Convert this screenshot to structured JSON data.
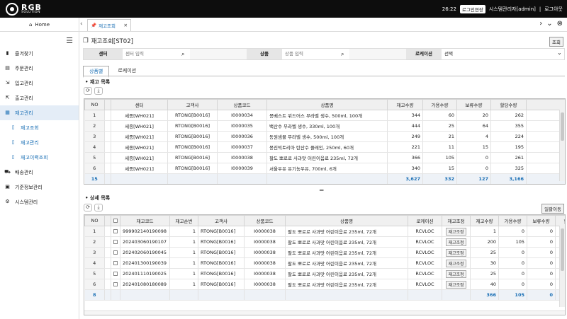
{
  "topbar": {
    "logo_main": "RGB",
    "logo_sub": "SOLUTION",
    "time": "26:22",
    "extend_label": "로그인연장",
    "user": "시스템관리자[admin]",
    "separator": "|",
    "logout": "로그아웃"
  },
  "nav": {
    "home": "Home",
    "tab_label": "재고조회",
    "tab_close": "✕"
  },
  "sidebar": {
    "items": [
      {
        "label": "즐겨찾기",
        "icon": "bookmark-icon"
      },
      {
        "label": "주문관리",
        "icon": "document-icon"
      },
      {
        "label": "입고관리",
        "icon": "inbound-icon"
      },
      {
        "label": "출고관리",
        "icon": "outbound-icon"
      },
      {
        "label": "재고관리",
        "icon": "warehouse-icon"
      },
      {
        "label": "재고조회",
        "icon": "bookmark-outline-icon"
      },
      {
        "label": "재고관리",
        "icon": "bookmark-outline-icon"
      },
      {
        "label": "재고이력조회",
        "icon": "bookmark-outline-icon"
      },
      {
        "label": "배송관리",
        "icon": "truck-icon"
      },
      {
        "label": "기준정보관리",
        "icon": "clipboard-icon"
      },
      {
        "label": "시스템관리",
        "icon": "gear-icon"
      }
    ]
  },
  "page": {
    "title": "재고조회[ST02]",
    "help_label": "조회"
  },
  "search": {
    "center_label": "센터",
    "center_placeholder": "센터 입력",
    "product_label": "상품",
    "product_placeholder": "상품 입력",
    "location_label": "로케이션",
    "location_value": "선택"
  },
  "subtabs": [
    "상품별",
    "로케이션"
  ],
  "top": {
    "title": "재고 목록",
    "headers": [
      "NO",
      "센터",
      "고객사",
      "상품코드",
      "상품명",
      "재고수량",
      "가용수량",
      "보류수량",
      "할당수량"
    ],
    "rows": [
      [
        "1",
        "세종[WH021]",
        "RTONG[B0016]",
        "I0000034",
        "몽베스트 위드어스 무라벨 생수, 500ml, 100개",
        "344",
        "60",
        "20",
        "262"
      ],
      [
        "2",
        "세종[WH021]",
        "RTONG[B0016]",
        "I0000035",
        "백산수 무라벨 생수, 330ml, 100개",
        "444",
        "25",
        "64",
        "355"
      ],
      [
        "3",
        "세종[WH021]",
        "RTONG[B0016]",
        "I0000036",
        "동원샘물 무라벨 생수, 500ml, 100개",
        "249",
        "21",
        "4",
        "224"
      ],
      [
        "4",
        "세종[WH021]",
        "RTONG[B0016]",
        "I0000037",
        "몽진빅토리아 탄산수 플레인, 250ml, 60개",
        "221",
        "11",
        "15",
        "195"
      ],
      [
        "5",
        "세종[WH021]",
        "RTONG[B0016]",
        "I0000038",
        "팔도 뽀로로 사과맛 어린이음료 235ml, 72개",
        "366",
        "105",
        "0",
        "261"
      ],
      [
        "6",
        "세종[WH021]",
        "RTONG[B0016]",
        "I0000039",
        "서울우유 유기농우유, 700ml, 6개",
        "340",
        "15",
        "0",
        "325"
      ]
    ],
    "footer": {
      "count": "15",
      "stock": "3,627",
      "avail": "332",
      "hold": "127",
      "alloc": "3,166"
    }
  },
  "bottom": {
    "title": "상세 목록",
    "export_label": "일괄이동",
    "headers": [
      "NO",
      "",
      "재고코드",
      "재고순번",
      "고객사",
      "상품코드",
      "상품명",
      "로케이션",
      "재고조정",
      "재고수량",
      "가용수량",
      "보류수량",
      "할당수량"
    ],
    "rows": [
      [
        "1",
        "999902140190098",
        "1",
        "RTONG[B0016]",
        "I0000038",
        "팔도 뽀로로 사과맛 어린이음료 235ml, 72개",
        "RCVLOC",
        "재고조정",
        "1",
        "0",
        "0",
        "1"
      ],
      [
        "2",
        "202403060190107",
        "1",
        "RTONG[B0016]",
        "I0000038",
        "팔도 뽀로로 사과맛 어린이음료 235ml, 72개",
        "RCVLOC",
        "재고조정",
        "200",
        "105",
        "0",
        "95"
      ],
      [
        "3",
        "202402060190045",
        "1",
        "RTONG[B0016]",
        "I0000038",
        "팔도 뽀로로 사과맛 어린이음료 235ml, 72개",
        "RCVLOC",
        "재고조정",
        "25",
        "0",
        "0",
        "25"
      ],
      [
        "4",
        "202401300190039",
        "1",
        "RTONG[B0016]",
        "I0000038",
        "팔도 뽀로로 사과맛 어린이음료 235ml, 72개",
        "RCVLOC",
        "재고조정",
        "30",
        "0",
        "0",
        "30"
      ],
      [
        "5",
        "202401110190025",
        "1",
        "RTONG[B0016]",
        "I0000038",
        "팔도 뽀로로 사과맛 어린이음료 235ml, 72개",
        "RCVLOC",
        "재고조정",
        "25",
        "0",
        "0",
        "25"
      ],
      [
        "6",
        "202401080180089",
        "1",
        "RTONG[B0016]",
        "I0000038",
        "팔도 뽀로로 사과맛 어린이음료 235ml, 72개",
        "RCVLOC",
        "재고조정",
        "40",
        "0",
        "0",
        "40"
      ]
    ],
    "footer": {
      "count": "8",
      "stock": "366",
      "avail": "105",
      "hold": "0",
      "alloc": "2"
    }
  },
  "colors": {
    "accent": "#1a6fb5",
    "topbar": "#0d0d0d",
    "active_menu_bg": "#e4edf7"
  }
}
